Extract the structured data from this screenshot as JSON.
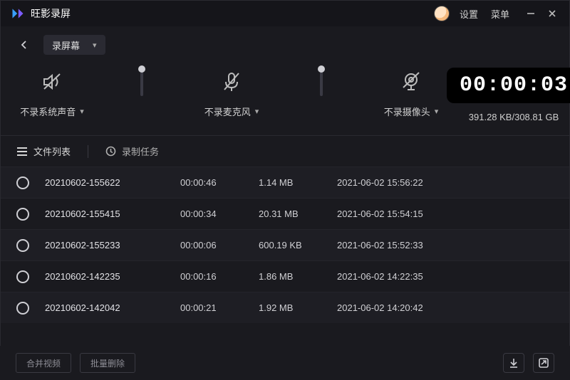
{
  "app": {
    "title": "旺影录屏"
  },
  "titlebar": {
    "settings": "设置",
    "menu": "菜单"
  },
  "mode": {
    "label": "录屏幕"
  },
  "audio_toggles": {
    "system": "不录系统声音",
    "mic": "不录麦克风",
    "camera": "不录摄像头"
  },
  "timer": {
    "value": "00:00:03",
    "size_line": "391.28 KB/308.81 GB"
  },
  "tabs": {
    "files": "文件列表",
    "tasks": "录制任务"
  },
  "rows": [
    {
      "name": "20210602-155622",
      "dur": "00:00:46",
      "size": "1.14 MB",
      "date": "2021-06-02 15:56:22"
    },
    {
      "name": "20210602-155415",
      "dur": "00:00:34",
      "size": "20.31 MB",
      "date": "2021-06-02 15:54:15"
    },
    {
      "name": "20210602-155233",
      "dur": "00:00:06",
      "size": "600.19 KB",
      "date": "2021-06-02 15:52:33"
    },
    {
      "name": "20210602-142235",
      "dur": "00:00:16",
      "size": "1.86 MB",
      "date": "2021-06-02 14:22:35"
    },
    {
      "name": "20210602-142042",
      "dur": "00:00:21",
      "size": "1.92 MB",
      "date": "2021-06-02 14:20:42"
    }
  ],
  "footer": {
    "merge": "合并视频",
    "batch_delete": "批量删除"
  }
}
